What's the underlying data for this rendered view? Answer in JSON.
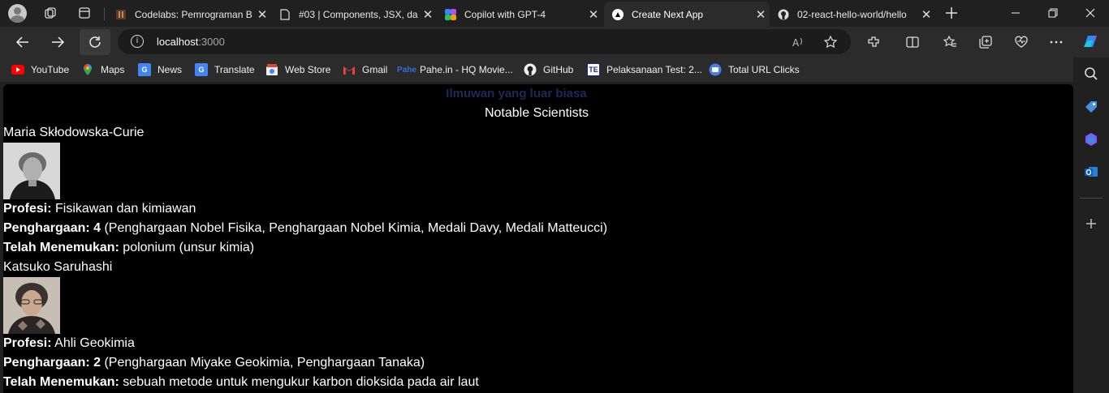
{
  "tabs": [
    {
      "title": "Codelabs: Pemrograman B",
      "icon": "codelabs-icon",
      "active": false
    },
    {
      "title": "#03 | Components, JSX, da",
      "icon": "document-icon",
      "active": false
    },
    {
      "title": "Copilot with GPT-4",
      "icon": "copilot-icon",
      "active": false
    },
    {
      "title": "Create Next App",
      "icon": "nextjs-icon",
      "active": true
    },
    {
      "title": "02-react-hello-world/hello",
      "icon": "github-icon",
      "active": false
    }
  ],
  "address_bar": {
    "host": "localhost",
    "port": ":3000"
  },
  "bookmarks": [
    {
      "label": "YouTube",
      "icon": "youtube-icon"
    },
    {
      "label": "Maps",
      "icon": "maps-icon"
    },
    {
      "label": "News",
      "icon": "news-icon"
    },
    {
      "label": "Translate",
      "icon": "translate-icon"
    },
    {
      "label": "Web Store",
      "icon": "webstore-icon"
    },
    {
      "label": "Gmail",
      "icon": "gmail-icon"
    },
    {
      "label": "Pahe.in - HQ Movie...",
      "icon": "pahe-icon"
    },
    {
      "label": "GitHub",
      "icon": "github-icon"
    },
    {
      "label": "Pelaksanaan Test: 2...",
      "icon": "test-icon"
    },
    {
      "label": "Total URL Clicks",
      "icon": "link-icon"
    }
  ],
  "page": {
    "heading": "Ilmuwan yang luar biasa",
    "title": "Notable Scientists",
    "scientists": [
      {
        "name": "Maria Skłodowska-Curie",
        "profession_label": "Profesi:",
        "profession": " Fisikawan dan kimiawan",
        "awards_label": "Penghargaan: 4",
        "awards": " (Penghargaan Nobel Fisika, Penghargaan Nobel Kimia, Medali Davy, Medali Matteucci)",
        "discovered_label": "Telah Menemukan:",
        "discovered": " polonium (unsur kimia)"
      },
      {
        "name": "Katsuko Saruhashi",
        "profession_label": "Profesi:",
        "profession": " Ahli Geokimia",
        "awards_label": "Penghargaan: 2",
        "awards": " (Penghargaan Miyake Geokimia, Penghargaan Tanaka)",
        "discovered_label": "Telah Menemukan:",
        "discovered": " sebuah metode untuk mengukur karbon dioksida pada air laut"
      }
    ]
  },
  "colors": {
    "heading": "#1e2a55",
    "page_bg": "#000000",
    "chrome_bg": "#202020",
    "toolbar_bg": "#2b2b2b"
  }
}
